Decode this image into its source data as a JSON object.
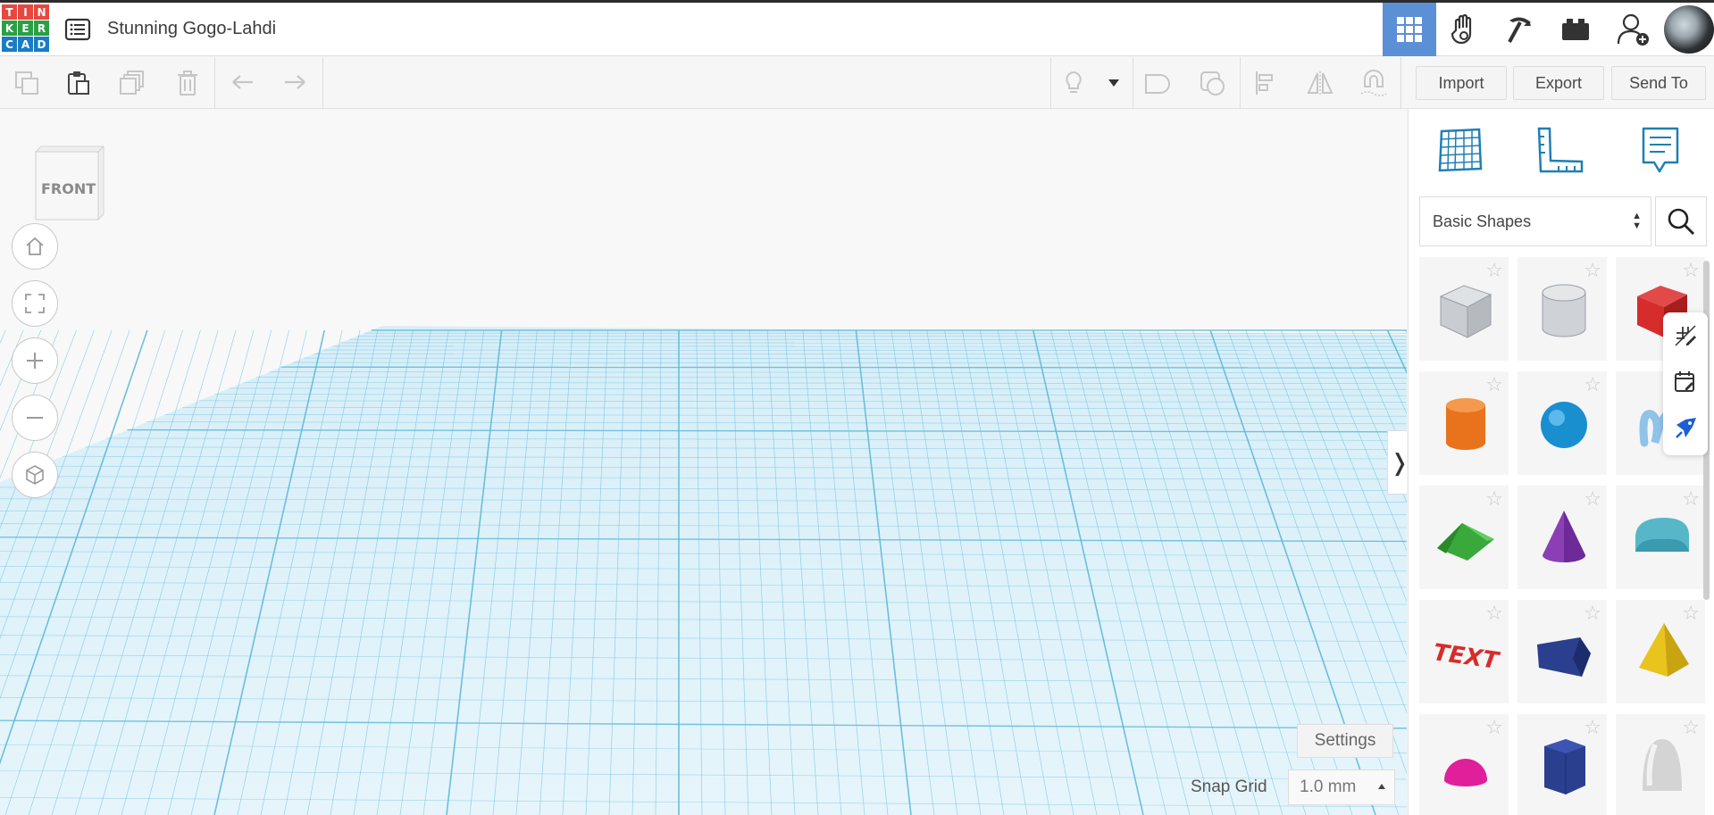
{
  "header": {
    "logo_letters": [
      "T",
      "I",
      "N",
      "K",
      "E",
      "R",
      "C",
      "A",
      "D"
    ],
    "logo_colors": [
      "#e8473f",
      "#e8473f",
      "#e8473f",
      "#2aa043",
      "#2aa043",
      "#2aa043",
      "#1a7cc4",
      "#1a7cc4",
      "#1a7cc4"
    ],
    "design_list_icon": "list-icon",
    "design_title": "Stunning Gogo-Lahdi",
    "view_buttons": [
      {
        "name": "3d-design-view",
        "icon": "grid-icon",
        "active": true
      },
      {
        "name": "circuits-view",
        "icon": "hand-icon",
        "active": false
      },
      {
        "name": "minecraft-view",
        "icon": "pickaxe-icon",
        "active": false
      },
      {
        "name": "bricks-view",
        "icon": "brick-icon",
        "active": false
      }
    ],
    "invite_icon": "add-user-icon",
    "accent_color": "#5b8fd6"
  },
  "toolbar": {
    "left_icons": [
      "copy-icon",
      "paste-icon",
      "duplicate-icon",
      "delete-icon",
      "undo-icon",
      "redo-icon"
    ],
    "right_icons": [
      "light-bulb-icon",
      "dropdown-icon",
      "shape-note-icon",
      "group-icon",
      "align-icon",
      "mirror-icon",
      "magnet-icon"
    ],
    "import_label": "Import",
    "export_label": "Export",
    "send_to_label": "Send To"
  },
  "workplane": {
    "view_cube_label": "FRONT",
    "nav_buttons": [
      "home-icon",
      "fit-view-icon",
      "zoom-in-icon",
      "zoom-out-icon",
      "perspective-icon"
    ],
    "settings_label": "Settings",
    "snap_grid_label": "Snap Grid",
    "snap_grid_value": "1.0 mm",
    "grid_color": "#5fb8d9"
  },
  "right_panel": {
    "top_icons": [
      "workplane-icon",
      "ruler-icon",
      "notes-icon"
    ],
    "library_selected": "Basic Shapes",
    "search_icon": "search-icon",
    "shapes": [
      {
        "name": "box-hole",
        "color": "#c4c8cc"
      },
      {
        "name": "cylinder-hole",
        "color": "#c4c8cc"
      },
      {
        "name": "box",
        "color": "#d62c2c"
      },
      {
        "name": "cylinder",
        "color": "#e8731c"
      },
      {
        "name": "sphere",
        "color": "#1a8fd0"
      },
      {
        "name": "scribble",
        "color": "#8fc3e8"
      },
      {
        "name": "roof",
        "color": "#3aa83a"
      },
      {
        "name": "cone",
        "color": "#8a3fb5"
      },
      {
        "name": "round-roof",
        "color": "#58b6c9"
      },
      {
        "name": "text",
        "color": "#d62c2c",
        "label": "TEXT"
      },
      {
        "name": "wedge",
        "color": "#2b3f8f"
      },
      {
        "name": "pyramid",
        "color": "#e8c41c"
      },
      {
        "name": "half-sphere",
        "color": "#e0209a"
      },
      {
        "name": "polygon",
        "color": "#2b3f8f"
      },
      {
        "name": "paraboloid",
        "color": "#d4d4d4"
      }
    ],
    "float_tools": [
      "edit-grid-icon",
      "calendar-edit-icon",
      "ai-assist-icon"
    ]
  }
}
